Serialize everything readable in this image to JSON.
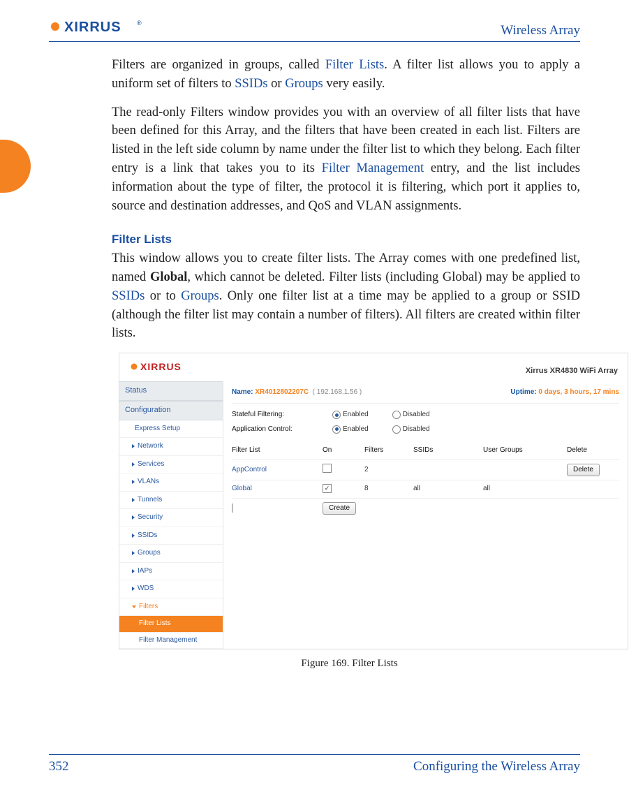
{
  "header": {
    "product": "Wireless Array",
    "logo_text": "XIRRUS"
  },
  "content": {
    "para1_a": "Filters are organized in groups, called ",
    "para1_link1": "Filter Lists",
    "para1_b": ". A filter list allows you to apply a uniform set of filters to ",
    "para1_link2": "SSIDs",
    "para1_c": " or ",
    "para1_link3": "Groups",
    "para1_d": " very easily.",
    "para2_a": "The read-only Filters window provides you with an overview of all filter lists that have been defined for this Array, and the filters that have been created in each list. Filters are listed in the left side column by name under the filter list to which they belong. Each filter entry is a link that takes you to its ",
    "para2_link": "Filter Management",
    "para2_b": " entry, and the list includes information about the type of filter, the protocol it is filtering, which port it applies to, source and destination addresses, and QoS and VLAN assignments.",
    "heading": "Filter Lists",
    "para3_a": "This window allows you to create filter lists. The Array comes with one predefined list, named ",
    "para3_bold": "Global",
    "para3_b": ", which cannot be deleted. Filter lists (including Global) may be applied to ",
    "para3_link1": "SSIDs",
    "para3_c": " or to ",
    "para3_link2": "Groups",
    "para3_d": ". Only one filter list at a time may be applied to a group or SSID (although the filter list may contain a number of filters). All filters are created within filter lists."
  },
  "shot": {
    "logo_text": "XIRRUS",
    "device": "Xirrus XR4830 WiFi Array",
    "name_label": "Name:",
    "name_value": "XR4012802207C",
    "ip": "( 192.168.1.56 )",
    "uptime_label": "Uptime:",
    "uptime_value": "0 days, 3 hours, 17 mins",
    "nav": {
      "status": "Status",
      "config": "Configuration",
      "express": "Express Setup",
      "items": [
        "Network",
        "Services",
        "VLANs",
        "Tunnels",
        "Security",
        "SSIDs",
        "Groups",
        "IAPs",
        "WDS"
      ],
      "filters": "Filters",
      "sub1": "Filter Lists",
      "sub2": "Filter Management"
    },
    "rows": {
      "stateful_label": "Stateful Filtering:",
      "appctrl_label": "Application Control:",
      "enabled": "Enabled",
      "disabled": "Disabled"
    },
    "table": {
      "headers": [
        "Filter List",
        "On",
        "Filters",
        "SSIDs",
        "User Groups",
        "Delete"
      ],
      "r1": {
        "name": "AppControl",
        "on": false,
        "filters": "2",
        "ssids": "",
        "groups": "",
        "btn": "Delete"
      },
      "r2": {
        "name": "Global",
        "on": true,
        "filters": "8",
        "ssids": "all",
        "groups": "all"
      },
      "create_btn": "Create"
    }
  },
  "figure_caption": "Figure 169. Filter Lists",
  "footer": {
    "page": "352",
    "section": "Configuring the Wireless Array"
  }
}
